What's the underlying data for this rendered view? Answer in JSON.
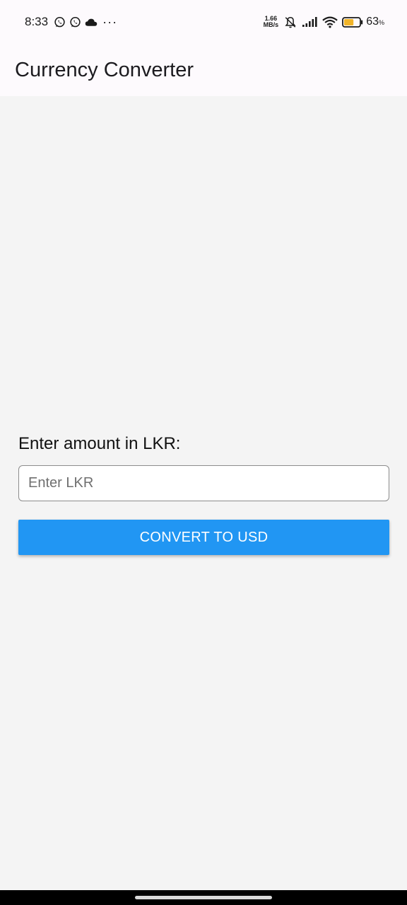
{
  "status_bar": {
    "time": "8:33",
    "icons_left": [
      "whatsapp-icon",
      "whatsapp-icon",
      "cloud-icon"
    ],
    "more": "···",
    "speed_value": "1.66",
    "speed_unit": "MB/s",
    "battery_percent": "63",
    "battery_unit": "%",
    "battery_level": 0.63,
    "battery_color": "#f0b429"
  },
  "app_bar": {
    "title": "Currency Converter"
  },
  "form": {
    "label": "Enter amount in LKR:",
    "input_value": "",
    "input_placeholder": "Enter LKR",
    "button_label": "CONVERT TO USD",
    "accent_color": "#2196f3"
  }
}
